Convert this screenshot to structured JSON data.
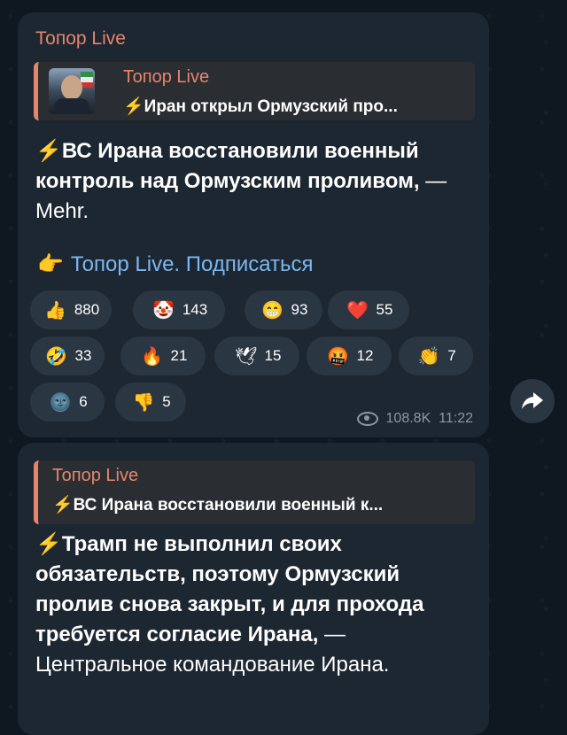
{
  "post1": {
    "channel": "Топор Live",
    "reply": {
      "title": "Топор Live",
      "bolt": "⚡",
      "text": "Иран открыл Ормузский про..."
    },
    "bolt": "⚡",
    "message_bold": "ВС Ирана восстановили военный контроль над Ормузским проливом,",
    "message_rest": " — Mehr.",
    "subscribe": {
      "hand": "👉",
      "text": "Топор Live. Подписаться"
    },
    "reactions": [
      {
        "emoji": "👍",
        "count": "880"
      },
      {
        "emoji": "🤡",
        "count": "143"
      },
      {
        "emoji": "😁",
        "count": "93"
      },
      {
        "emoji": "❤️",
        "count": "55"
      },
      {
        "emoji": "🤣",
        "count": "33"
      },
      {
        "emoji": "🔥",
        "count": "21"
      },
      {
        "emoji": "🕊",
        "count": "15"
      },
      {
        "emoji": "🤬",
        "count": "12"
      },
      {
        "emoji": "👏",
        "count": "7"
      },
      {
        "emoji": "🌚",
        "count": "6"
      },
      {
        "emoji": "👎",
        "count": "5"
      }
    ],
    "views": "108.8K",
    "time": "11:22"
  },
  "post2": {
    "reply": {
      "title": "Топор Live",
      "bolt": "⚡",
      "text": "ВС Ирана восстановили военный к..."
    },
    "bolt": "⚡",
    "message_bold": "Трамп не выполнил своих обязательств, поэтому Ормузский пролив снова закрыт, и для прохода требуется согласие Ирана,",
    "message_rest": " — Центральное командование Ирана."
  },
  "icons": {
    "share": "share-arrow-icon",
    "eye": "eye-icon"
  }
}
